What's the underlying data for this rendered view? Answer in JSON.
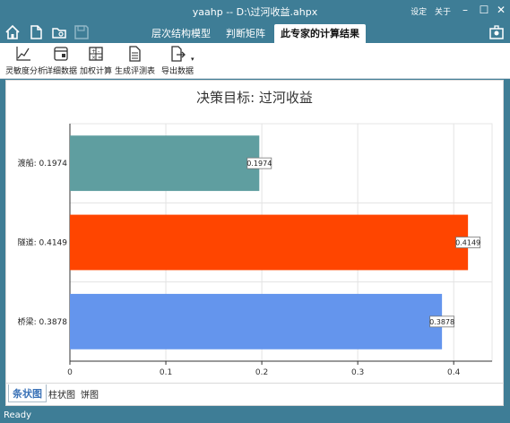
{
  "window": {
    "title": "yaahp -- D:\\过河收益.ahpx",
    "menu_settings": "设定",
    "menu_about": "关于"
  },
  "tabs": [
    {
      "label": "层次结构模型"
    },
    {
      "label": "判断矩阵"
    },
    {
      "label": "此专家的计算结果"
    }
  ],
  "toolbar": [
    {
      "label": "灵敏度分析",
      "icon": "line-chart-icon"
    },
    {
      "label": "详细数据",
      "icon": "window-icon"
    },
    {
      "label": "加权计算",
      "icon": "calculator-icon"
    },
    {
      "label": "生成评测表",
      "icon": "document-icon"
    },
    {
      "label": "导出数据",
      "icon": "export-icon"
    }
  ],
  "chart_data": {
    "type": "bar",
    "orientation": "horizontal",
    "title": "决策目标: 过河收益",
    "categories": [
      "桥梁: 0.3878",
      "隧道: 0.4149",
      "渡船: 0.1974"
    ],
    "values": [
      0.3878,
      0.4149,
      0.1974
    ],
    "value_labels": [
      "0.3878",
      "0.4149",
      "0.1974"
    ],
    "colors": [
      "#6495ed",
      "#ff4500",
      "#5f9ea0"
    ],
    "xlim": [
      0,
      0.44
    ],
    "xticks": [
      0,
      0.1,
      0.2,
      0.3,
      0.4
    ],
    "xtick_labels": [
      "0",
      "0.1",
      "0.2",
      "0.3",
      "0.4"
    ],
    "grid": true
  },
  "bottom_tabs": [
    {
      "label": "条状图"
    },
    {
      "label": "柱状图"
    },
    {
      "label": "饼图"
    }
  ],
  "status": "Ready"
}
